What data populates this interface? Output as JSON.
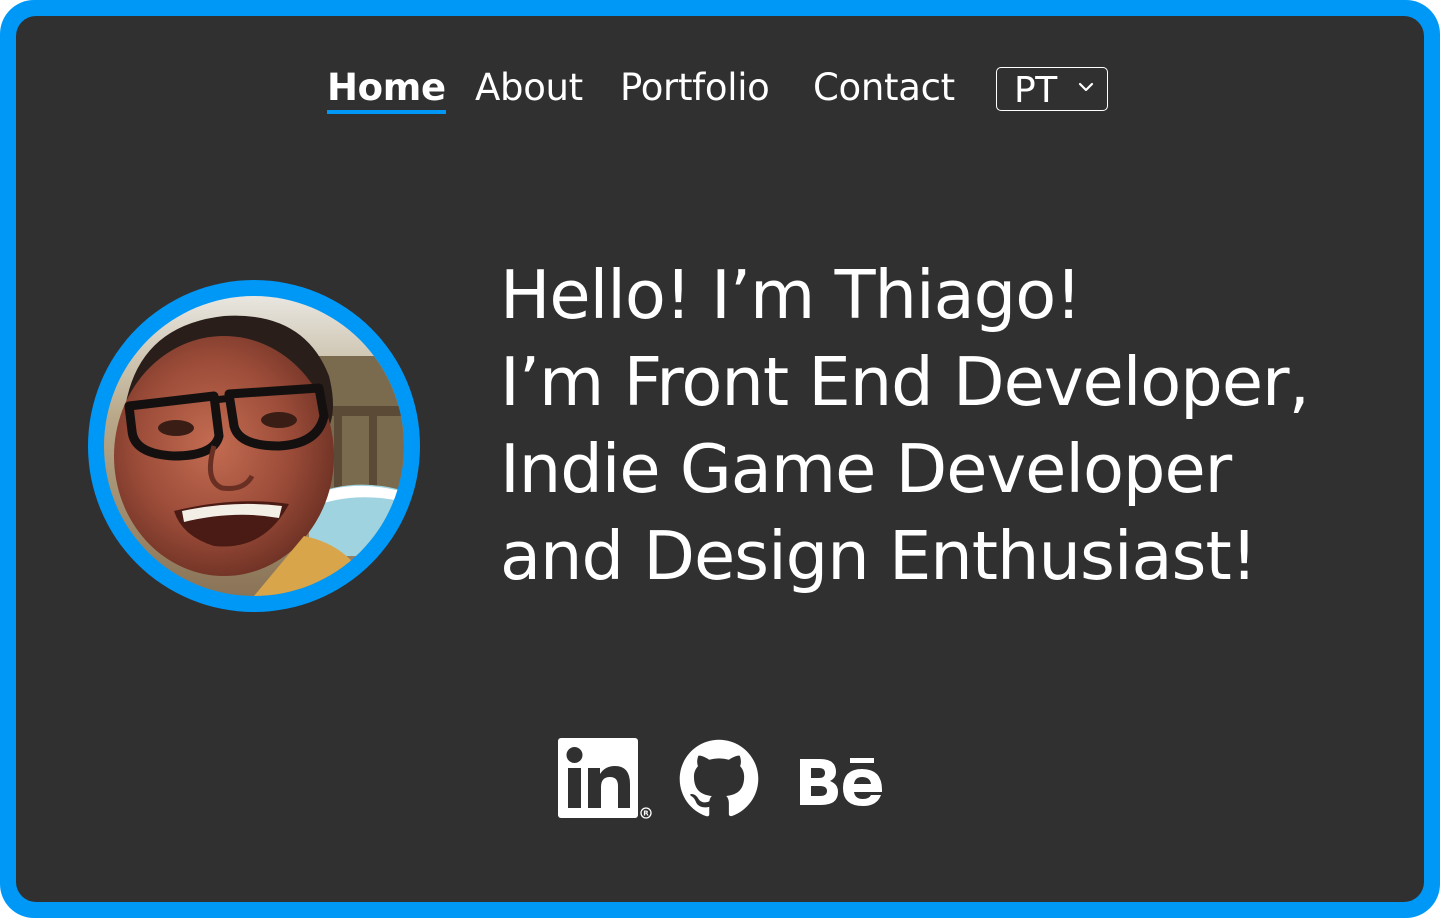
{
  "nav": {
    "items": [
      {
        "label": "Home",
        "active": true
      },
      {
        "label": "About"
      },
      {
        "label": "Portfolio"
      },
      {
        "label": "Contact"
      }
    ],
    "language": {
      "selected": "PT"
    }
  },
  "hero": {
    "lines": [
      "Hello! I’m Thiago!",
      "I’m Front End Developer,",
      "Indie Game Developer",
      "and Design Enthusiast!"
    ]
  },
  "social": {
    "icons": [
      "linkedin-icon",
      "github-icon",
      "behance-icon"
    ]
  },
  "colors": {
    "accent": "#0098f7",
    "background": "#303030",
    "text": "#ffffff"
  }
}
